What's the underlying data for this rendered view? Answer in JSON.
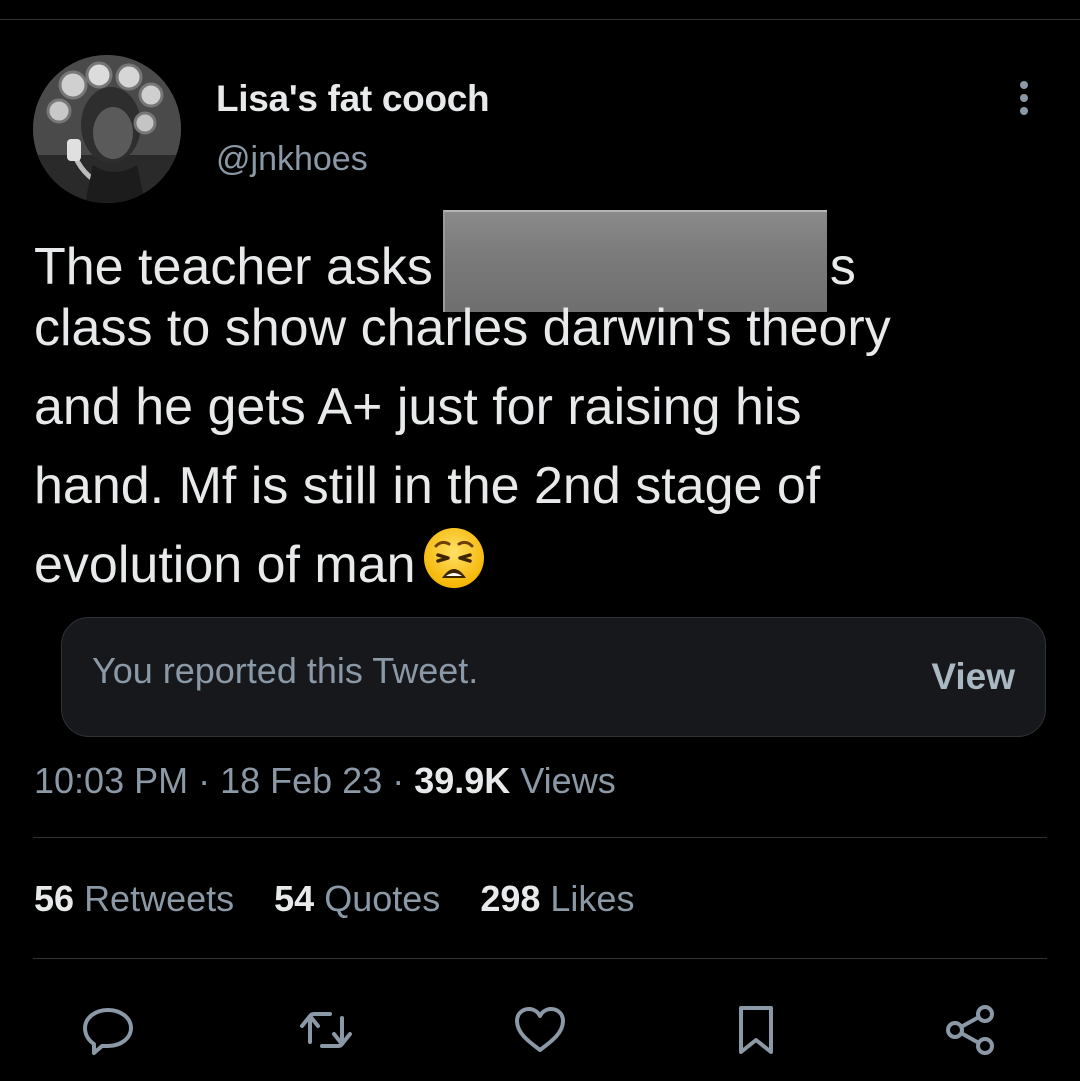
{
  "user": {
    "display_name": "Lisa's fat cooch",
    "handle": "@jnkhoes"
  },
  "tweet": {
    "lines": [
      "The teacher asks",
      "s",
      "class to show charles darwin's theory",
      "and he gets A+ just for raising his",
      "hand. Mf is still in the 2nd stage of",
      "evolution of man"
    ],
    "emoji": "weary-face"
  },
  "report": {
    "text": "You reported this Tweet.",
    "view_label": "View"
  },
  "meta": {
    "time": "10:03 PM",
    "separator": "·",
    "date": "18 Feb 23",
    "views_count": "39.9K",
    "views_label": "Views"
  },
  "stats": {
    "retweets_count": "56",
    "retweets_label": "Retweets",
    "quotes_count": "54",
    "quotes_label": "Quotes",
    "likes_count": "298",
    "likes_label": "Likes"
  },
  "actions": [
    "reply-icon",
    "retweet-icon",
    "like-icon",
    "bookmark-icon",
    "share-icon"
  ],
  "colors": {
    "background": "#000000",
    "primary_text": "#e7e9ea",
    "secondary_text": "#8b98a5",
    "divider": "#2f3336",
    "report_box": "#16181c"
  }
}
